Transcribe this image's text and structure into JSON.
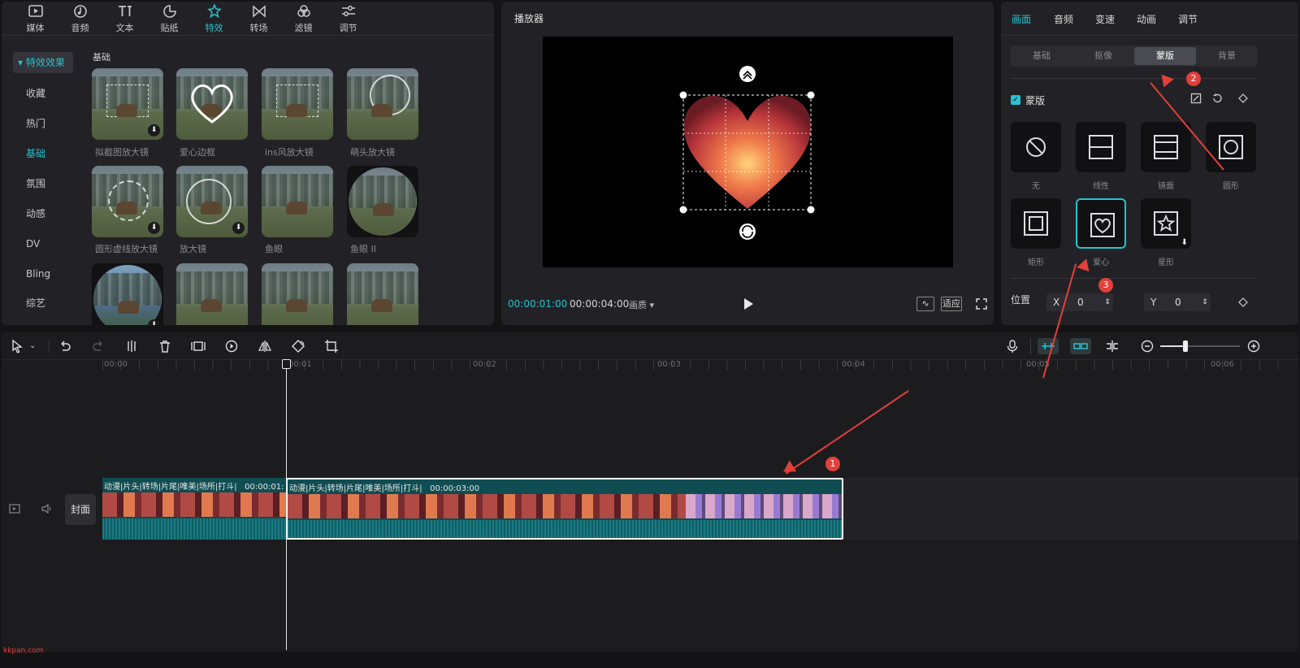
{
  "top_tabs": [
    {
      "label": "媒体",
      "icon": "media-icon"
    },
    {
      "label": "音频",
      "icon": "audio-icon"
    },
    {
      "label": "文本",
      "icon": "text-icon"
    },
    {
      "label": "贴纸",
      "icon": "sticker-icon"
    },
    {
      "label": "特效",
      "icon": "effects-icon",
      "active": true
    },
    {
      "label": "转场",
      "icon": "transition-icon"
    },
    {
      "label": "滤镜",
      "icon": "filter-icon"
    },
    {
      "label": "调节",
      "icon": "adjust-icon"
    }
  ],
  "categories": [
    "特效效果",
    "收藏",
    "热门",
    "基础",
    "氛围",
    "动感",
    "DV",
    "Bling",
    "综艺"
  ],
  "active_category": "基础",
  "section_title": "基础",
  "effects": [
    {
      "label": "拟截图放大镜",
      "download": true
    },
    {
      "label": "爱心边框",
      "download": false
    },
    {
      "label": "ins风放大镜",
      "download": false
    },
    {
      "label": "萌头放大镜",
      "download": false
    },
    {
      "label": "圆形虚线放大镜",
      "download": true
    },
    {
      "label": "放大镜",
      "download": true
    },
    {
      "label": "鱼眼",
      "download": false
    },
    {
      "label": "鱼眼 II",
      "download": false
    },
    {
      "label": "",
      "download": true
    },
    {
      "label": "",
      "download": false
    },
    {
      "label": "",
      "download": false
    },
    {
      "label": "",
      "download": false
    }
  ],
  "player": {
    "title": "播放器",
    "current_time": "00:00:01:00",
    "total_time": "00:00:04:00",
    "quality": "画质",
    "fit_label": "适应"
  },
  "props": {
    "tabs": [
      "画面",
      "音频",
      "变速",
      "动画",
      "调节"
    ],
    "active_tab": "画面",
    "subtabs": [
      "基础",
      "抠像",
      "蒙版",
      "背景"
    ],
    "active_subtab": "蒙版",
    "mask_label": "蒙版",
    "masks": [
      {
        "label": "无",
        "icon": "none-icon"
      },
      {
        "label": "线性",
        "icon": "linear-icon"
      },
      {
        "label": "镜面",
        "icon": "mirror-icon"
      },
      {
        "label": "圆形",
        "icon": "circle-icon"
      },
      {
        "label": "矩形",
        "icon": "rectangle-icon"
      },
      {
        "label": "爱心",
        "icon": "heart-icon",
        "active": true
      },
      {
        "label": "星形",
        "icon": "star-icon"
      }
    ],
    "position_label": "位置",
    "x_label": "X",
    "x_value": "0",
    "y_label": "Y",
    "y_value": "0"
  },
  "timeline": {
    "ruler_ticks": [
      "00:00",
      "00:01",
      "00:02",
      "00:03",
      "00:04",
      "00:05",
      "00:06"
    ],
    "cover_label": "封面",
    "clips": [
      {
        "caption": "动漫|片头|转场|片尾|唯美|场所|打斗|",
        "duration": "00:00:01:"
      },
      {
        "caption": "动漫|片头|转场|片尾|唯美|场所|打斗|",
        "duration": "00:00:03:00"
      }
    ]
  },
  "annotations": [
    "1",
    "2",
    "3"
  ],
  "watermark": "kkpan.com",
  "colors": {
    "accent": "#27c2cf",
    "annotation": "#e2403a"
  }
}
